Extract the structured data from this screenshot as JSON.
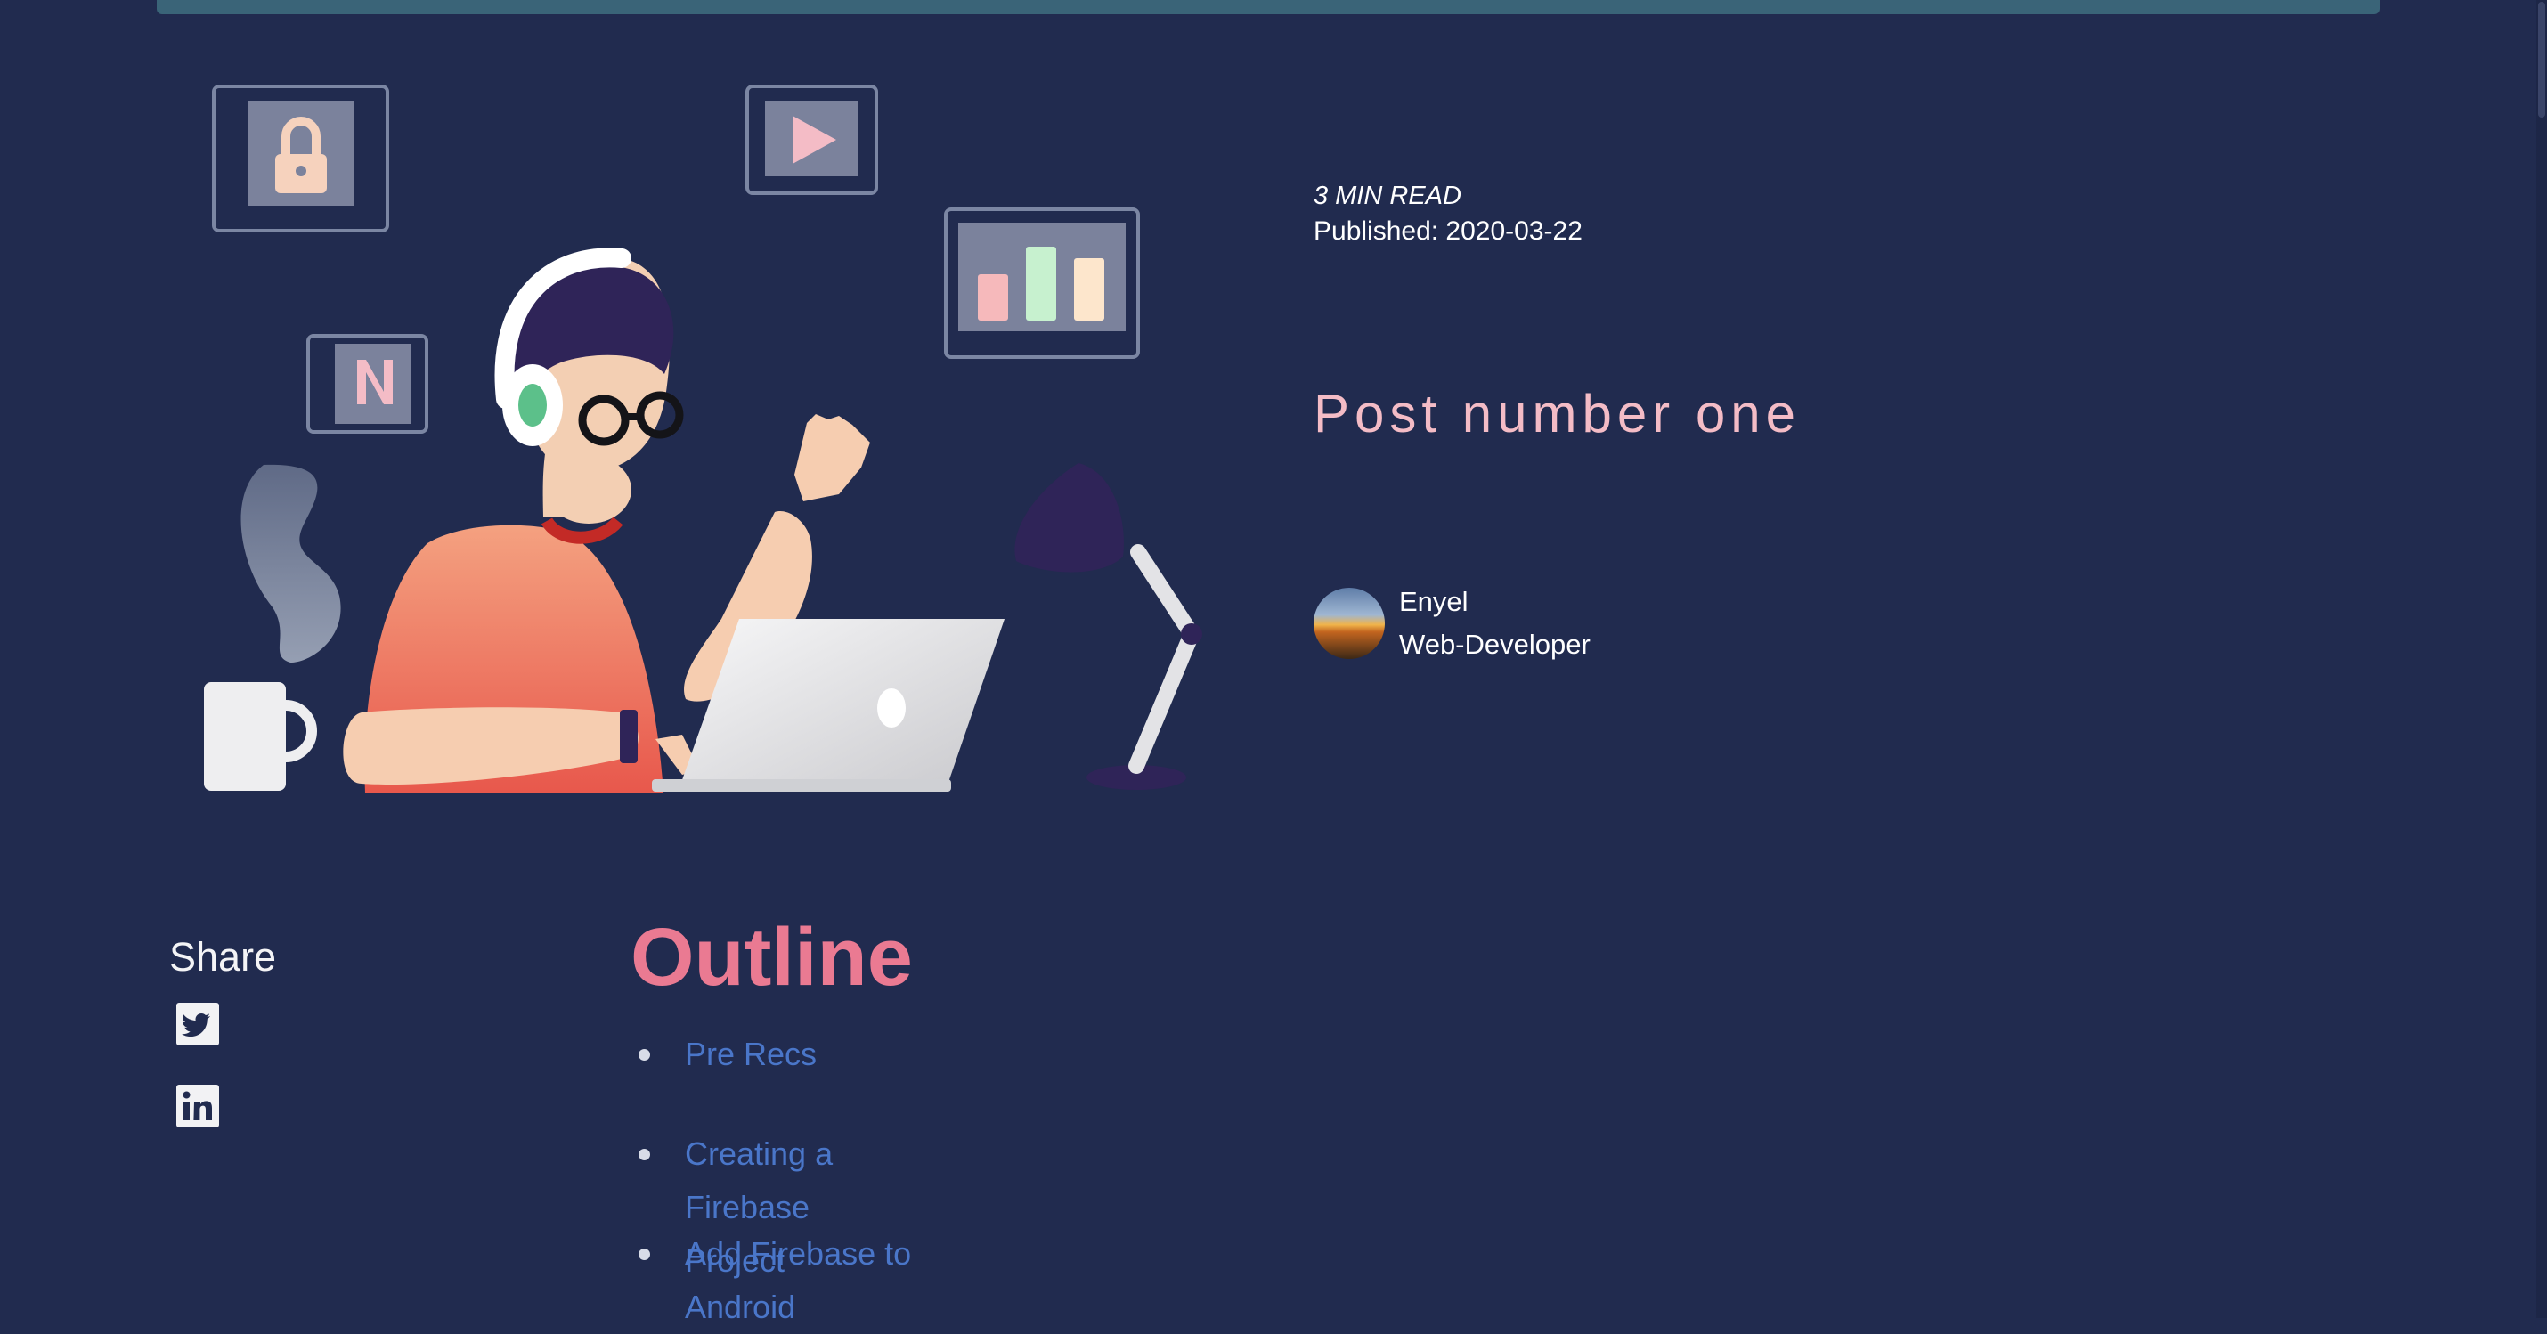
{
  "post": {
    "read_time": "3 MIN READ",
    "published": "Published: 2020-03-22",
    "title": "Post number one"
  },
  "author": {
    "name": "Enyel",
    "role": "Web-Developer",
    "avatar_icon": "avatar-photo"
  },
  "share": {
    "title": "Share",
    "buttons": [
      {
        "icon": "twitter-icon"
      },
      {
        "icon": "linkedin-icon"
      }
    ]
  },
  "outline": {
    "title": "Outline",
    "items": [
      {
        "label": "Pre Recs"
      },
      {
        "label": "Creating a Firebase Project"
      },
      {
        "label": "Add Firebase to Android"
      }
    ]
  },
  "colors": {
    "background": "#212b4f",
    "title": "#f4bcc6",
    "outline_heading": "#ea7a92",
    "link": "#4a76c9",
    "top_bar": "#3a6478"
  },
  "hero": {
    "icons": [
      "lock-icon",
      "play-icon",
      "bar-chart-icon",
      "netflix-n-icon",
      "desk-lamp-icon",
      "coffee-mug-icon",
      "laptop-icon"
    ]
  }
}
